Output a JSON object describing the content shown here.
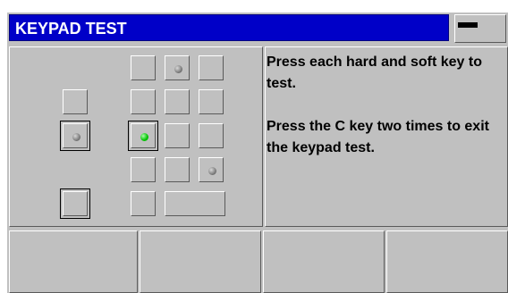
{
  "header": {
    "title": "KEYPAD TEST",
    "mode_indicator": "minus-bar-icon"
  },
  "message": {
    "line1": "Press each hard and soft key to test.",
    "line2": "Press the C key two times to exit the keypad test."
  },
  "keypad": {
    "pressed_key_led": "green",
    "idle_led": "gray"
  },
  "softkeys": [
    "",
    "",
    "",
    ""
  ],
  "colors": {
    "titlebar": "#0000c8",
    "panel": "#c0c0c0",
    "led_active": "#00c000"
  }
}
